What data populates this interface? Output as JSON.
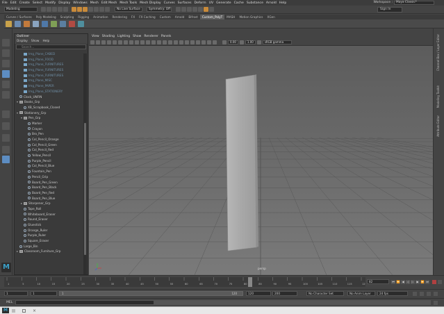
{
  "menubar": {
    "items": [
      "File",
      "Edit",
      "Create",
      "Select",
      "Modify",
      "Display",
      "Windows",
      "Mesh",
      "Edit Mesh",
      "Mesh Tools",
      "Mesh Display",
      "Curves",
      "Surfaces",
      "Deform",
      "UV",
      "Generate",
      "Cache",
      "Substance",
      "Arnold",
      "Help"
    ],
    "workspace_label": "Workspace :",
    "workspace_value": "Maya Classic*"
  },
  "statusline": {
    "mode": "Modeling",
    "live_surface": "No Live Surface",
    "symmetry": "Symmetry: Off",
    "sign_in": "Sign In"
  },
  "shelf": {
    "tabs": [
      "Curves / Surfaces",
      "Poly Modeling",
      "Sculpting",
      "Rigging",
      "Animation",
      "Rendering",
      "FX",
      "FX Caching",
      "Custom",
      "Arnold",
      "Bifrost",
      "Custom_PolyT",
      "MASH",
      "Motion Graphics",
      "XGen"
    ],
    "active_tab": 11
  },
  "outliner": {
    "title": "Outliner",
    "menu": [
      "Display",
      "Show",
      "Help"
    ],
    "search_placeholder": "Search...",
    "items": [
      {
        "label": "Img_Plane_CABED",
        "type": "mesh",
        "depth": 1,
        "dim": true
      },
      {
        "label": "Img_Plane_FOOD",
        "type": "mesh",
        "depth": 1,
        "dim": true
      },
      {
        "label": "Img_Plane_FURNITURES",
        "type": "mesh",
        "depth": 1,
        "dim": true
      },
      {
        "label": "Img_Plane_FURNITURES",
        "type": "mesh",
        "depth": 1,
        "dim": true
      },
      {
        "label": "Img_Plane_FURNITURES",
        "type": "mesh",
        "depth": 1,
        "dim": true
      },
      {
        "label": "Img_Plane_MISC",
        "type": "mesh",
        "depth": 1,
        "dim": true
      },
      {
        "label": "Img_Plane_PAPER",
        "type": "mesh",
        "depth": 1,
        "dim": true
      },
      {
        "label": "Img_Plane_STATIONERY",
        "type": "mesh",
        "depth": 1,
        "dim": true
      },
      {
        "label": "Clock_UNFIN",
        "type": "loc",
        "depth": 0,
        "dim": false
      },
      {
        "label": "Books_Grp",
        "type": "grp",
        "depth": 0,
        "dim": false,
        "open": true
      },
      {
        "label": "XB_Scrapbook_Closed",
        "type": "loc",
        "depth": 1,
        "dim": false
      },
      {
        "label": "Stationery_Grp",
        "type": "grp",
        "depth": 0,
        "dim": false,
        "open": true
      },
      {
        "label": "Pen_Grp",
        "type": "grp",
        "depth": 1,
        "dim": false,
        "open": true
      },
      {
        "label": "Marker",
        "type": "loc",
        "depth": 2,
        "dim": false
      },
      {
        "label": "Crayon",
        "type": "loc",
        "depth": 2,
        "dim": false
      },
      {
        "label": "Bro_Pen",
        "type": "loc",
        "depth": 2,
        "dim": false
      },
      {
        "label": "Col_Pencil_Orange",
        "type": "loc",
        "depth": 2,
        "dim": false
      },
      {
        "label": "Col_Pencil_Green",
        "type": "loc",
        "depth": 2,
        "dim": false
      },
      {
        "label": "Col_Pencil_Red",
        "type": "loc",
        "depth": 2,
        "dim": false
      },
      {
        "label": "Yellow_Pencil",
        "type": "loc",
        "depth": 2,
        "dim": false
      },
      {
        "label": "Purple_Pencil",
        "type": "loc",
        "depth": 2,
        "dim": false
      },
      {
        "label": "Col_Pencil_Blue",
        "type": "loc",
        "depth": 2,
        "dim": false
      },
      {
        "label": "Fountain_Pen",
        "type": "loc",
        "depth": 2,
        "dim": false
      },
      {
        "label": "Pencil_Grip",
        "type": "loc",
        "depth": 2,
        "dim": false
      },
      {
        "label": "Board_Pen_Green",
        "type": "loc",
        "depth": 2,
        "dim": false
      },
      {
        "label": "Board_Pen_Black",
        "type": "loc",
        "depth": 2,
        "dim": false
      },
      {
        "label": "Board_Pen_Red",
        "type": "loc",
        "depth": 2,
        "dim": false
      },
      {
        "label": "Board_Pen_Blue",
        "type": "loc",
        "depth": 2,
        "dim": false
      },
      {
        "label": "Sharpener_Grp",
        "type": "grp",
        "depth": 1,
        "dim": false
      },
      {
        "label": "Tape_Roll",
        "type": "loc",
        "depth": 1,
        "dim": false
      },
      {
        "label": "Whiteboard_Eraser",
        "type": "loc",
        "depth": 1,
        "dim": false
      },
      {
        "label": "Round_Eraser",
        "type": "loc",
        "depth": 1,
        "dim": false
      },
      {
        "label": "Gluestick",
        "type": "loc",
        "depth": 1,
        "dim": false
      },
      {
        "label": "Orange_Ruler",
        "type": "loc",
        "depth": 1,
        "dim": false
      },
      {
        "label": "Purple_Ruler",
        "type": "loc",
        "depth": 1,
        "dim": false
      },
      {
        "label": "Square_Eraser",
        "type": "loc",
        "depth": 1,
        "dim": false
      },
      {
        "label": "Large_Bin",
        "type": "loc",
        "depth": 0,
        "dim": false
      },
      {
        "label": "Classroom_Furniture_Grp",
        "type": "grp",
        "depth": 0,
        "dim": false
      }
    ]
  },
  "viewport": {
    "menu": [
      "View",
      "Shading",
      "Lighting",
      "Show",
      "Renderer",
      "Panels"
    ],
    "exposure": "0.00",
    "gamma": "1.00",
    "color_space": "sRGB gamma",
    "camera_label": "persp"
  },
  "right_tabs": [
    "Channel Box / Layer Editor",
    "Modeling Toolkit",
    "Attribute Editor"
  ],
  "timeslider": {
    "current_frame": "82",
    "current_frame_field": "82",
    "ticks": [
      "1",
      "5",
      "10",
      "15",
      "20",
      "25",
      "30",
      "35",
      "40",
      "45",
      "50",
      "55",
      "60",
      "65",
      "70",
      "75",
      "80",
      "85",
      "90",
      "95",
      "100",
      "105",
      "110",
      "115",
      "120"
    ]
  },
  "rangeslider": {
    "start": "1",
    "playback_start": "1",
    "range_start_label": "1",
    "range_end_label": "120",
    "playback_end": "120",
    "end": "200",
    "character_set": "No Character Set",
    "anim_layer": "No Anim Layer",
    "fps": "24 fps"
  },
  "cmdline": {
    "label": "MEL"
  },
  "colors": {
    "viewport_bg": "#6b6b6b",
    "ui_bg": "#444444",
    "accent": "#5d8dc2"
  }
}
